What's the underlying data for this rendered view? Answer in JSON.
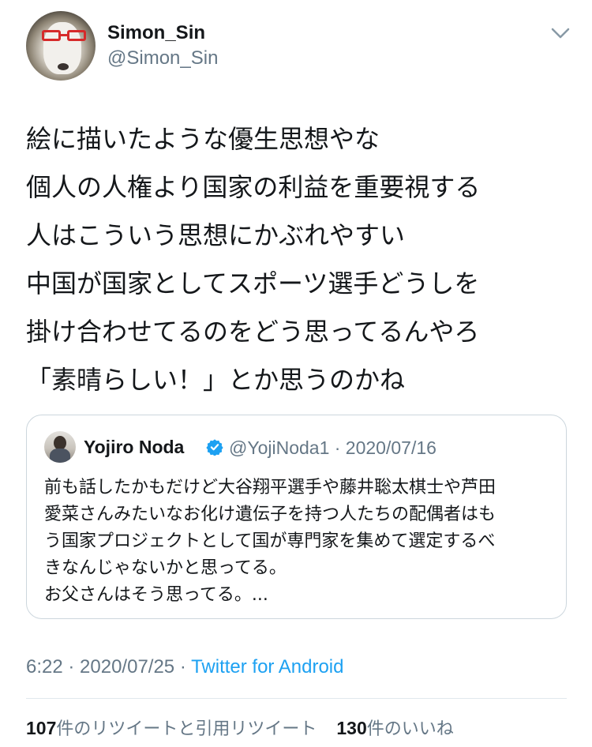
{
  "user": {
    "name": "Simon_Sin",
    "handle": "@Simon_Sin"
  },
  "icons": {
    "menu": "chevron-down-icon",
    "verified": "verified-badge-icon"
  },
  "tweet": {
    "lines": [
      "絵に描いたような優生思想やな",
      "個人の人権より国家の利益を重要視する",
      "人はこういう思想にかぶれやすい",
      "中国が国家としてスポーツ選手どうしを",
      "掛け合わせてるのをどう思ってるんやろ",
      "「素晴らしい！」とか思うのかね"
    ]
  },
  "quote": {
    "name": "Yojiro Noda",
    "meta": "@YojiNoda1 · 2020/07/16",
    "lines": [
      "前も話したかもだけど大谷翔平選手や藤井聡太棋士や芦田",
      "愛菜さんみたいなお化け遺伝子を持つ人たちの配偶者はも",
      "う国家プロジェクトとして国が専門家を集めて選定するべ",
      "きなんじゃないかと思ってる。",
      "お父さんはそう思ってる。..."
    ]
  },
  "footer": {
    "time": "6:22 · 2020/07/25 · ",
    "source": "Twitter for Android"
  },
  "stats": {
    "retweets_count": "107",
    "retweets_label": "件のリツイートと引用リツイート",
    "likes_count": "130",
    "likes_label": "件のいいね"
  },
  "colors": {
    "accent": "#1da1f2",
    "secondary_text": "#657786",
    "border": "#ccd6dd",
    "verified": "#1da1f2"
  }
}
